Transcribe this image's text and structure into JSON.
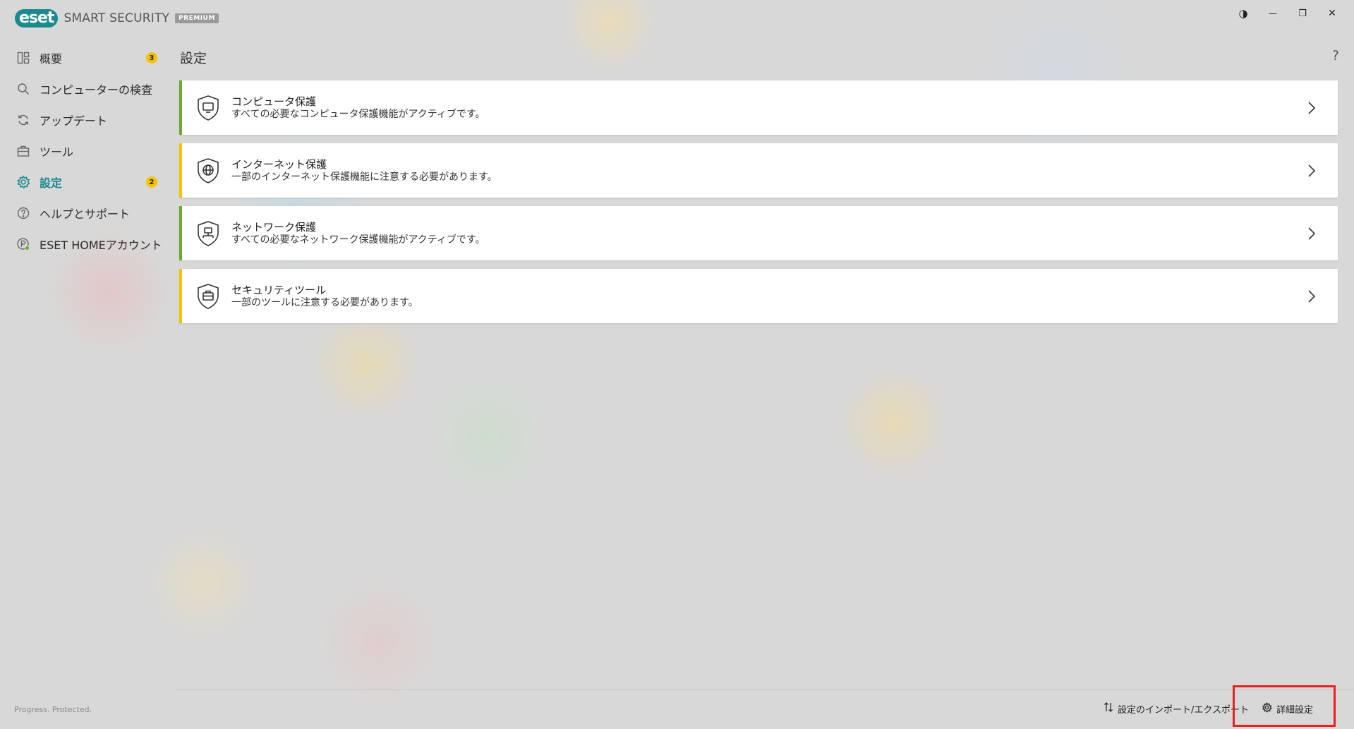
{
  "header": {
    "logo_mark": "eset",
    "product_name": "SMART SECURITY",
    "tier": "PREMIUM",
    "controls": [
      {
        "name": "theme-toggle",
        "glyph": "◑"
      },
      {
        "name": "minimize",
        "glyph": "—"
      },
      {
        "name": "restore",
        "glyph": "❐"
      },
      {
        "name": "close",
        "glyph": "✕"
      }
    ]
  },
  "sidebar": {
    "items": [
      {
        "label": "概要",
        "icon": "dashboard-icon",
        "badge": "3",
        "active": false
      },
      {
        "label": "コンピューターの検査",
        "icon": "search-icon",
        "badge": "",
        "active": false
      },
      {
        "label": "アップデート",
        "icon": "refresh-icon",
        "badge": "",
        "active": false
      },
      {
        "label": "ツール",
        "icon": "toolbox-icon",
        "badge": "",
        "active": false
      },
      {
        "label": "設定",
        "icon": "gear-icon",
        "badge": "2",
        "active": true
      },
      {
        "label": "ヘルプとサポート",
        "icon": "help-circle-icon",
        "badge": "",
        "active": false
      },
      {
        "label": "ESET HOMEアカウント",
        "icon": "account-icon",
        "badge": "",
        "active": false
      }
    ],
    "tagline": "Progress. Protected."
  },
  "main": {
    "title": "設定",
    "help": "?",
    "cards": [
      {
        "title": "コンピュータ保護",
        "subtitle": "すべての必要なコンピュータ保護機能がアクティブです。",
        "status": "ok",
        "icon": "shield-computer-icon"
      },
      {
        "title": "インターネット保護",
        "subtitle": "一部のインターネット保護機能に注意する必要があります。",
        "status": "warning",
        "icon": "shield-globe-icon"
      },
      {
        "title": "ネットワーク保護",
        "subtitle": "すべての必要なネットワーク保護機能がアクティブです。",
        "status": "ok",
        "icon": "shield-network-icon"
      },
      {
        "title": "セキュリティツール",
        "subtitle": "一部のツールに注意する必要があります。",
        "status": "warning",
        "icon": "shield-briefcase-icon"
      }
    ]
  },
  "footer": {
    "import_export": "設定のインポート/エクスポート",
    "advanced": "詳細設定"
  },
  "colors": {
    "accent": "#1a8a8f",
    "ok": "#6aa82e",
    "warning": "#f5c400",
    "highlight": "#e52222"
  }
}
